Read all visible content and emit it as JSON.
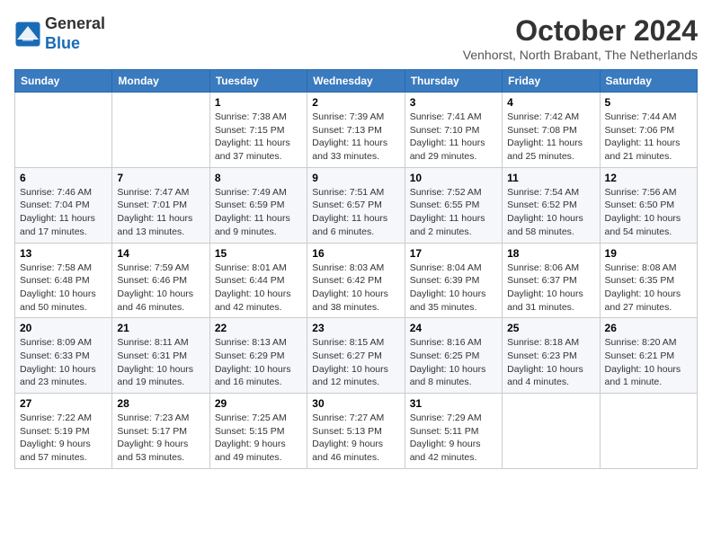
{
  "header": {
    "logo_line1": "General",
    "logo_line2": "Blue",
    "month_title": "October 2024",
    "subtitle": "Venhorst, North Brabant, The Netherlands"
  },
  "weekdays": [
    "Sunday",
    "Monday",
    "Tuesday",
    "Wednesday",
    "Thursday",
    "Friday",
    "Saturday"
  ],
  "weeks": [
    [
      {
        "day": "",
        "info": ""
      },
      {
        "day": "",
        "info": ""
      },
      {
        "day": "1",
        "info": "Sunrise: 7:38 AM\nSunset: 7:15 PM\nDaylight: 11 hours and 37 minutes."
      },
      {
        "day": "2",
        "info": "Sunrise: 7:39 AM\nSunset: 7:13 PM\nDaylight: 11 hours and 33 minutes."
      },
      {
        "day": "3",
        "info": "Sunrise: 7:41 AM\nSunset: 7:10 PM\nDaylight: 11 hours and 29 minutes."
      },
      {
        "day": "4",
        "info": "Sunrise: 7:42 AM\nSunset: 7:08 PM\nDaylight: 11 hours and 25 minutes."
      },
      {
        "day": "5",
        "info": "Sunrise: 7:44 AM\nSunset: 7:06 PM\nDaylight: 11 hours and 21 minutes."
      }
    ],
    [
      {
        "day": "6",
        "info": "Sunrise: 7:46 AM\nSunset: 7:04 PM\nDaylight: 11 hours and 17 minutes."
      },
      {
        "day": "7",
        "info": "Sunrise: 7:47 AM\nSunset: 7:01 PM\nDaylight: 11 hours and 13 minutes."
      },
      {
        "day": "8",
        "info": "Sunrise: 7:49 AM\nSunset: 6:59 PM\nDaylight: 11 hours and 9 minutes."
      },
      {
        "day": "9",
        "info": "Sunrise: 7:51 AM\nSunset: 6:57 PM\nDaylight: 11 hours and 6 minutes."
      },
      {
        "day": "10",
        "info": "Sunrise: 7:52 AM\nSunset: 6:55 PM\nDaylight: 11 hours and 2 minutes."
      },
      {
        "day": "11",
        "info": "Sunrise: 7:54 AM\nSunset: 6:52 PM\nDaylight: 10 hours and 58 minutes."
      },
      {
        "day": "12",
        "info": "Sunrise: 7:56 AM\nSunset: 6:50 PM\nDaylight: 10 hours and 54 minutes."
      }
    ],
    [
      {
        "day": "13",
        "info": "Sunrise: 7:58 AM\nSunset: 6:48 PM\nDaylight: 10 hours and 50 minutes."
      },
      {
        "day": "14",
        "info": "Sunrise: 7:59 AM\nSunset: 6:46 PM\nDaylight: 10 hours and 46 minutes."
      },
      {
        "day": "15",
        "info": "Sunrise: 8:01 AM\nSunset: 6:44 PM\nDaylight: 10 hours and 42 minutes."
      },
      {
        "day": "16",
        "info": "Sunrise: 8:03 AM\nSunset: 6:42 PM\nDaylight: 10 hours and 38 minutes."
      },
      {
        "day": "17",
        "info": "Sunrise: 8:04 AM\nSunset: 6:39 PM\nDaylight: 10 hours and 35 minutes."
      },
      {
        "day": "18",
        "info": "Sunrise: 8:06 AM\nSunset: 6:37 PM\nDaylight: 10 hours and 31 minutes."
      },
      {
        "day": "19",
        "info": "Sunrise: 8:08 AM\nSunset: 6:35 PM\nDaylight: 10 hours and 27 minutes."
      }
    ],
    [
      {
        "day": "20",
        "info": "Sunrise: 8:09 AM\nSunset: 6:33 PM\nDaylight: 10 hours and 23 minutes."
      },
      {
        "day": "21",
        "info": "Sunrise: 8:11 AM\nSunset: 6:31 PM\nDaylight: 10 hours and 19 minutes."
      },
      {
        "day": "22",
        "info": "Sunrise: 8:13 AM\nSunset: 6:29 PM\nDaylight: 10 hours and 16 minutes."
      },
      {
        "day": "23",
        "info": "Sunrise: 8:15 AM\nSunset: 6:27 PM\nDaylight: 10 hours and 12 minutes."
      },
      {
        "day": "24",
        "info": "Sunrise: 8:16 AM\nSunset: 6:25 PM\nDaylight: 10 hours and 8 minutes."
      },
      {
        "day": "25",
        "info": "Sunrise: 8:18 AM\nSunset: 6:23 PM\nDaylight: 10 hours and 4 minutes."
      },
      {
        "day": "26",
        "info": "Sunrise: 8:20 AM\nSunset: 6:21 PM\nDaylight: 10 hours and 1 minute."
      }
    ],
    [
      {
        "day": "27",
        "info": "Sunrise: 7:22 AM\nSunset: 5:19 PM\nDaylight: 9 hours and 57 minutes."
      },
      {
        "day": "28",
        "info": "Sunrise: 7:23 AM\nSunset: 5:17 PM\nDaylight: 9 hours and 53 minutes."
      },
      {
        "day": "29",
        "info": "Sunrise: 7:25 AM\nSunset: 5:15 PM\nDaylight: 9 hours and 49 minutes."
      },
      {
        "day": "30",
        "info": "Sunrise: 7:27 AM\nSunset: 5:13 PM\nDaylight: 9 hours and 46 minutes."
      },
      {
        "day": "31",
        "info": "Sunrise: 7:29 AM\nSunset: 5:11 PM\nDaylight: 9 hours and 42 minutes."
      },
      {
        "day": "",
        "info": ""
      },
      {
        "day": "",
        "info": ""
      }
    ]
  ]
}
